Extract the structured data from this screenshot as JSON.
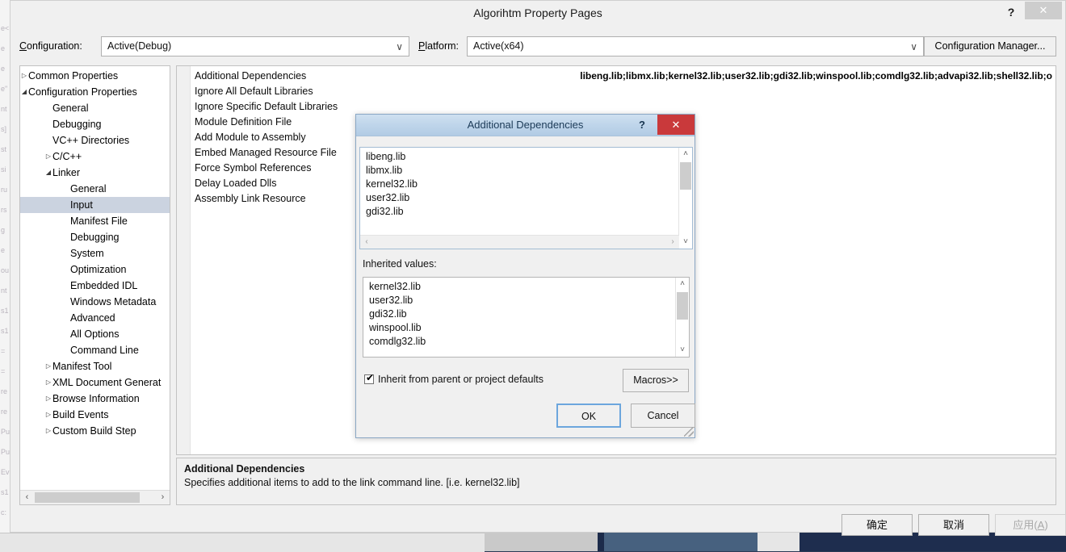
{
  "window": {
    "title": "Algorihtm Property Pages",
    "help_icon": "?",
    "close_icon": "✕"
  },
  "config_bar": {
    "configuration_label": "Configuration:",
    "configuration_value": "Active(Debug)",
    "platform_label": "Platform:",
    "platform_value": "Active(x64)",
    "dropdown_icon": "∨",
    "configuration_manager_button": "Configuration Manager..."
  },
  "tree": {
    "nodes": [
      {
        "label": "Common Properties",
        "indent": 10,
        "twisty": "▷",
        "selected": false
      },
      {
        "label": "Configuration Properties",
        "indent": 10,
        "twisty": "◢",
        "selected": false
      },
      {
        "label": "General",
        "indent": 40,
        "twisty": "",
        "selected": false
      },
      {
        "label": "Debugging",
        "indent": 40,
        "twisty": "",
        "selected": false
      },
      {
        "label": "VC++ Directories",
        "indent": 40,
        "twisty": "",
        "selected": false
      },
      {
        "label": "C/C++",
        "indent": 40,
        "twisty": "▷",
        "selected": false
      },
      {
        "label": "Linker",
        "indent": 40,
        "twisty": "◢",
        "selected": false
      },
      {
        "label": "General",
        "indent": 62,
        "twisty": "",
        "selected": false
      },
      {
        "label": "Input",
        "indent": 62,
        "twisty": "",
        "selected": true
      },
      {
        "label": "Manifest File",
        "indent": 62,
        "twisty": "",
        "selected": false
      },
      {
        "label": "Debugging",
        "indent": 62,
        "twisty": "",
        "selected": false
      },
      {
        "label": "System",
        "indent": 62,
        "twisty": "",
        "selected": false
      },
      {
        "label": "Optimization",
        "indent": 62,
        "twisty": "",
        "selected": false
      },
      {
        "label": "Embedded IDL",
        "indent": 62,
        "twisty": "",
        "selected": false
      },
      {
        "label": "Windows Metadata",
        "indent": 62,
        "twisty": "",
        "selected": false
      },
      {
        "label": "Advanced",
        "indent": 62,
        "twisty": "",
        "selected": false
      },
      {
        "label": "All Options",
        "indent": 62,
        "twisty": "",
        "selected": false
      },
      {
        "label": "Command Line",
        "indent": 62,
        "twisty": "",
        "selected": false
      },
      {
        "label": "Manifest Tool",
        "indent": 40,
        "twisty": "▷",
        "selected": false
      },
      {
        "label": "XML Document Generat",
        "indent": 40,
        "twisty": "▷",
        "selected": false
      },
      {
        "label": "Browse Information",
        "indent": 40,
        "twisty": "▷",
        "selected": false
      },
      {
        "label": "Build Events",
        "indent": 40,
        "twisty": "▷",
        "selected": false
      },
      {
        "label": "Custom Build Step",
        "indent": 40,
        "twisty": "▷",
        "selected": false
      }
    ],
    "scroll_left_icon": "‹",
    "scroll_right_icon": "›"
  },
  "grid": {
    "rows": [
      {
        "name": "Additional Dependencies",
        "value": "libeng.lib;libmx.lib;kernel32.lib;user32.lib;gdi32.lib;winspool.lib;comdlg32.lib;advapi32.lib;shell32.lib;o"
      },
      {
        "name": "Ignore All Default Libraries",
        "value": ""
      },
      {
        "name": "Ignore Specific Default Libraries",
        "value": ""
      },
      {
        "name": "Module Definition File",
        "value": ""
      },
      {
        "name": "Add Module to Assembly",
        "value": ""
      },
      {
        "name": "Embed Managed Resource File",
        "value": ""
      },
      {
        "name": "Force Symbol References",
        "value": ""
      },
      {
        "name": "Delay Loaded Dlls",
        "value": ""
      },
      {
        "name": "Assembly Link Resource",
        "value": ""
      }
    ]
  },
  "description": {
    "title": "Additional Dependencies",
    "text": "Specifies additional items to add to the link command line. [i.e. kernel32.lib]"
  },
  "footer": {
    "ok": "确定",
    "cancel": "取消",
    "apply_prefix": "应用(",
    "apply_key": "A",
    "apply_suffix": ")"
  },
  "dialog": {
    "title": "Additional Dependencies",
    "help_icon": "?",
    "close_icon": "✕",
    "main_list": [
      "libeng.lib",
      "libmx.lib",
      "kernel32.lib",
      "user32.lib",
      "gdi32.lib"
    ],
    "inherited_label": "Inherited values:",
    "inherited_list": [
      "kernel32.lib",
      "user32.lib",
      "gdi32.lib",
      "winspool.lib",
      "comdlg32.lib"
    ],
    "inherit_checkbox_label": "Inherit from parent or project defaults",
    "inherit_checkbox_checked": true,
    "checkbox_tick": "✔",
    "macros_button": "Macros>>",
    "ok_button": "OK",
    "cancel_button": "Cancel",
    "scroll_up_icon": "˄",
    "scroll_down_icon": "˅",
    "scroll_left_icon": "‹",
    "scroll_right_icon": "›"
  },
  "background": {
    "code_fragments": [
      "e<",
      "e",
      "e",
      "e\"",
      "nt",
      "s]",
      "st",
      "si",
      "ru",
      "rs",
      "g",
      "e",
      "ou",
      "nt",
      "s1",
      "s1",
      "=",
      "=",
      "re",
      "re",
      "Pu",
      "Pu",
      "Ev",
      "s1",
      "c:"
    ]
  },
  "colors": {
    "dialog_titlebar": "#bdd4ea",
    "close_button": "#c9393b",
    "selection": "#cbd3e0",
    "focus_border": "#6ca6dd",
    "window_chrome": "#f0f0f0"
  }
}
